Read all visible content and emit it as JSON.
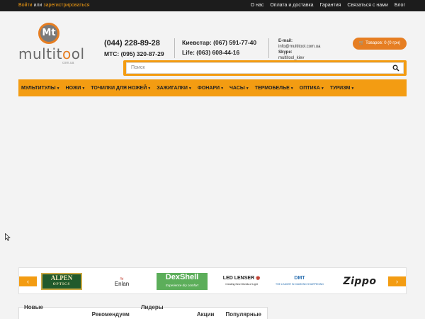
{
  "topbar": {
    "login": "Войти",
    "or": "или",
    "register": "зарегистрироваться",
    "nav": [
      "О нас",
      "Оплата и доставка",
      "Гарантия",
      "Связаться с нами",
      "Блог"
    ]
  },
  "logo": {
    "badge": "Mt",
    "word_start": "multit",
    "word_o": "o",
    "word_end": "ol",
    "sub": "com.ua"
  },
  "phones": {
    "main": "(044) 228-89-28",
    "mts": "МТС: (095) 320-87-29"
  },
  "operators": {
    "kyivstar": "Киевстар: (067) 591-77-40",
    "life": "Life: (063) 608-44-16"
  },
  "contacts": {
    "email_label": "E-mail:",
    "email": "info@multitool.com.ua",
    "skype_label": "Skype:",
    "skype": "multitool_kiev"
  },
  "cart": {
    "label": "Товаров: 0 (0 грн)"
  },
  "search": {
    "placeholder": "Поиск"
  },
  "menu": [
    "Мультитулы",
    "Ножи",
    "Точилки для ножей",
    "Зажигалки",
    "Фонари",
    "Часы",
    "Термобелье",
    "Оптика",
    "Туризм"
  ],
  "brands": {
    "alpen": "ALPEN",
    "alpen_sub": "OPTICS",
    "enlan": "Enlan",
    "dexshell": "DexShell",
    "dexshell_sub": "Experience dry comfort",
    "led": "LED LENSER",
    "led_sub": "Creating New Worlds of Light",
    "dmt": "DMT",
    "dmt_sub": "THE LEADER IN DIAMOND SHARPENING",
    "zippo": "Zippo"
  },
  "tabs": [
    "Новые поступления",
    "Рекомендуем",
    "Лидеры продаж",
    "Акции",
    "Популярные"
  ],
  "colors": {
    "accent": "#f39c12",
    "topbar": "#1c1c1c",
    "cart": "#e67e22"
  }
}
